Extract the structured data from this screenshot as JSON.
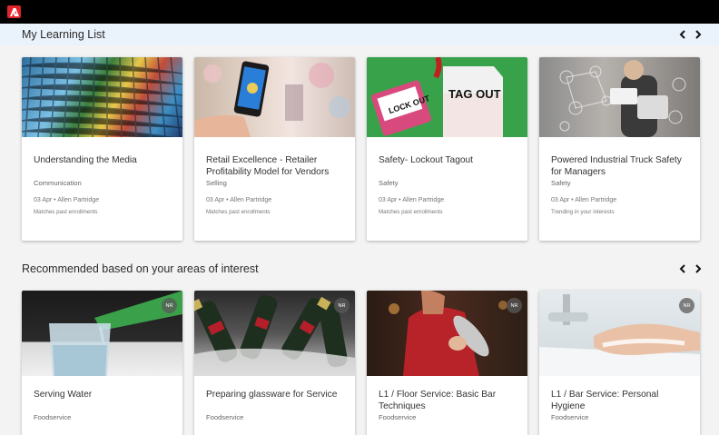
{
  "header": {
    "logo_icon": "adobe-logo-icon",
    "accent": "#e0242a"
  },
  "learning_list": {
    "title": "My Learning List",
    "cards": [
      {
        "title": "Understanding the Media",
        "category": "Communication",
        "meta": "03 Apr • Allen Partridge",
        "reason": "Matches past enrollments"
      },
      {
        "title": "Retail Excellence - Retailer Profitability Model for Vendors",
        "category": "Selling",
        "meta": "03 Apr • Allen Partridge",
        "reason": "Matches past enrollments"
      },
      {
        "title": "Safety- Lockout Tagout",
        "category": "Safety",
        "meta": "03 Apr • Allen Partridge",
        "reason": "Matches past enrollments",
        "sign_text_1": "LOCK OUT",
        "sign_text_2": "TAG OUT"
      },
      {
        "title": "Powered Industrial Truck Safety for Managers",
        "category": "Safety",
        "meta": "03 Apr • Allen Partridge",
        "reason": "Trending in your interests"
      }
    ]
  },
  "recommended": {
    "title": "Recommended based on your areas of interest",
    "cards": [
      {
        "title": "Serving Water",
        "category": "Foodservice",
        "badge": "NR"
      },
      {
        "title": "Preparing glassware for Service",
        "category": "Foodservice",
        "badge": "NR"
      },
      {
        "title": "L1 / Floor Service: Basic Bar Techniques",
        "category": "Foodservice",
        "badge": "NR"
      },
      {
        "title": "L1 / Bar Service: Personal Hygiene",
        "category": "Foodservice",
        "badge": "NR"
      }
    ]
  }
}
